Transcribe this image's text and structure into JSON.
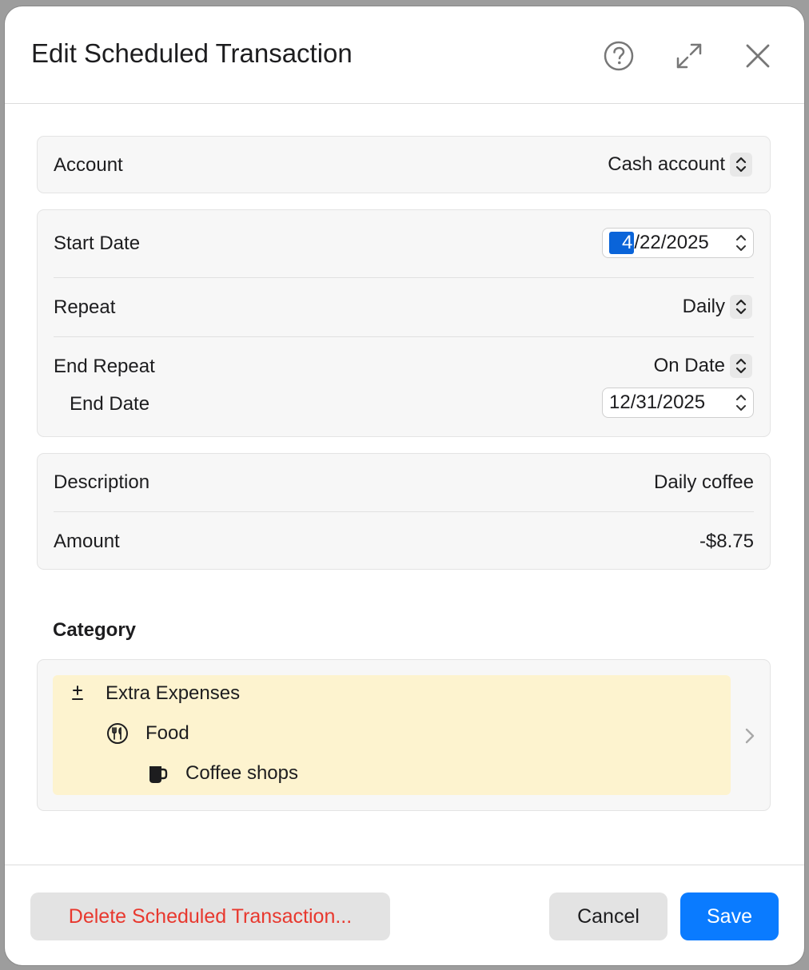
{
  "window": {
    "title": "Edit Scheduled Transaction"
  },
  "titlebar": {
    "help_icon": "question-circle-icon",
    "expand_icon": "expand-arrows-icon",
    "close_icon": "close-x-icon"
  },
  "account": {
    "label": "Account",
    "value": "Cash account"
  },
  "schedule": {
    "start_date_label": "Start Date",
    "start_date_selected_segment": "4",
    "start_date_rest": "/22/2025",
    "repeat_label": "Repeat",
    "repeat_value": "Daily",
    "end_repeat_label": "End Repeat",
    "end_repeat_value": "On Date",
    "end_date_label": "End Date",
    "end_date_value": "12/31/2025"
  },
  "details": {
    "description_label": "Description",
    "description_value": "Daily coffee",
    "amount_label": "Amount",
    "amount_value": "-$8.75"
  },
  "category": {
    "section_title": "Category",
    "path": [
      {
        "label": "Extra Expenses",
        "icon": "plus-minus-icon"
      },
      {
        "label": "Food",
        "icon": "fork-knife-circle-icon"
      },
      {
        "label": "Coffee shops",
        "icon": "coffee-mug-icon"
      }
    ],
    "highlight_color": "#fdf3cf"
  },
  "footer": {
    "delete_label": "Delete Scheduled Transaction...",
    "cancel_label": "Cancel",
    "save_label": "Save"
  },
  "colors": {
    "accent": "#0a7bff",
    "destructive": "#e8382e",
    "selection": "#0a64d9"
  }
}
